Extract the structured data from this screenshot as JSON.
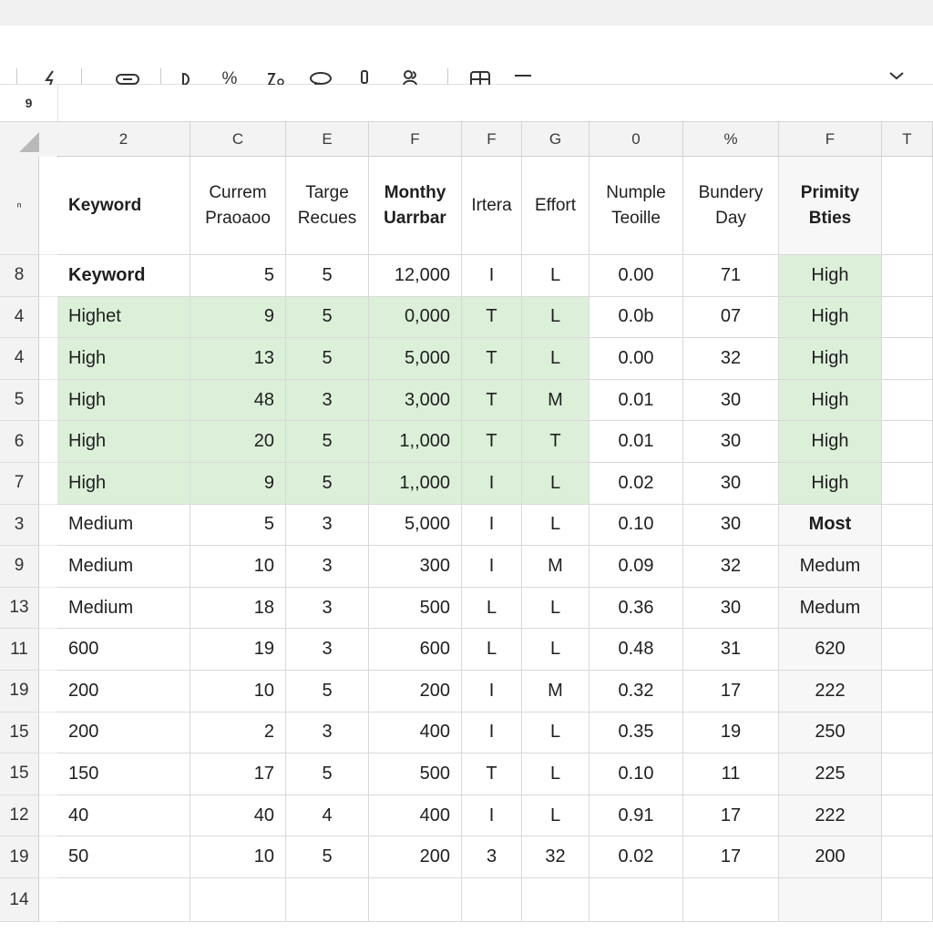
{
  "name_box": "9",
  "formula_value": "",
  "toolbar": [
    {
      "name": "format-painter-icon",
      "glyph": "ϟ"
    },
    {
      "name": "link-icon",
      "glyph": "⊂⊃"
    },
    {
      "name": "currency-icon",
      "glyph": "Ꝺ"
    },
    {
      "name": "percent-icon",
      "glyph": "%"
    },
    {
      "name": "decimal-icon",
      "glyph": "ƺ"
    },
    {
      "name": "comment-icon",
      "glyph": "◒"
    },
    {
      "name": "filter-icon",
      "glyph": "⏚"
    },
    {
      "name": "function-icon",
      "glyph": "ꝸ"
    },
    {
      "name": "table-icon",
      "glyph": "⊞"
    },
    {
      "name": "minus-icon",
      "glyph": "—"
    },
    {
      "name": "chevron-down-icon",
      "glyph": "⌄"
    }
  ],
  "columns": [
    "2",
    "C",
    "E",
    "F",
    "F",
    "G",
    "0",
    "%",
    "F",
    "T"
  ],
  "header_row": [
    "Keyword",
    "Currem Praoaoo",
    "Targe Recues",
    "Monthy Uarrbar",
    "Irtera",
    "Effort",
    "Numple Teoille",
    "Bundery Day",
    "Primity Bties"
  ],
  "row_numbers": [
    "8",
    "4",
    "4",
    "5",
    "6",
    "7",
    "3",
    "9",
    "13",
    "11",
    "19",
    "15",
    "15",
    "12",
    "19",
    "14"
  ],
  "rows": [
    [
      "Keyword",
      "5",
      "5",
      "12,000",
      "I",
      "L",
      "0.00",
      "71",
      "High"
    ],
    [
      "Highet",
      "9",
      "5",
      "0,000",
      "T",
      "L",
      "0.0b",
      "07",
      "High"
    ],
    [
      "High",
      "13",
      "5",
      "5,000",
      "T",
      "L",
      "0.00",
      "32",
      "High"
    ],
    [
      "High",
      "48",
      "3",
      "3,000",
      "T",
      "M",
      "0.01",
      "30",
      "High"
    ],
    [
      "High",
      "20",
      "5",
      "1,,000",
      "T",
      "T",
      "0.01",
      "30",
      "High"
    ],
    [
      "High",
      "9",
      "5",
      "1,,000",
      "I",
      "L",
      "0.02",
      "30",
      "High"
    ],
    [
      "Medium",
      "5",
      "3",
      "5,000",
      "I",
      "L",
      "0.10",
      "30",
      "Most"
    ],
    [
      "Medium",
      "10",
      "3",
      "300",
      "I",
      "M",
      "0.09",
      "32",
      "Medum"
    ],
    [
      "Medium",
      "18",
      "3",
      "500",
      "L",
      "L",
      "0.36",
      "30",
      "Medum"
    ],
    [
      "600",
      "19",
      "3",
      "600",
      "L",
      "L",
      "0.48",
      "31",
      "620"
    ],
    [
      "200",
      "10",
      "5",
      "200",
      "I",
      "M",
      "0.32",
      "17",
      "222"
    ],
    [
      "200",
      "2",
      "3",
      "400",
      "I",
      "L",
      "0.35",
      "19",
      "250"
    ],
    [
      "150",
      "17",
      "5",
      "500",
      "T",
      "L",
      "0.10",
      "11",
      "225"
    ],
    [
      "40",
      "40",
      "4",
      "400",
      "I",
      "L",
      "0.91",
      "17",
      "222"
    ],
    [
      "50",
      "10",
      "5",
      "200",
      "3",
      "32",
      "0.02",
      "17",
      "200"
    ],
    [
      "",
      "",
      "",
      "",
      "",
      "",
      "",
      "",
      ""
    ]
  ],
  "highlight_color": "#dcf0d9"
}
